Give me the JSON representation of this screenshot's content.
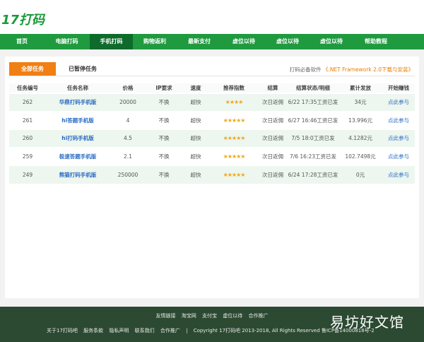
{
  "logo": "17打码",
  "nav": [
    "首页",
    "电脑打码",
    "手机打码",
    "购物返利",
    "最新支付",
    "虚位以待",
    "虚位以待",
    "虚位以待",
    "帮助教程"
  ],
  "tabs": {
    "all": "全部任务",
    "paused": "已暂停任务"
  },
  "notice": {
    "prefix": "打码必备软件 ",
    "link": "《.NET Framework 2.0下载与安装》"
  },
  "table": {
    "headers": [
      "任务编号",
      "任务名称",
      "价格",
      "IP要求",
      "速度",
      "推荐指数",
      "结算",
      "结算状态/明细",
      "累计发放",
      "开始赚钱"
    ],
    "rows": [
      {
        "id": "262",
        "name": "华鼎打码手机版",
        "price": "20000",
        "ip": "不换",
        "speed": "超快",
        "stars": 4,
        "settle": "次日返佣",
        "status": "6/22 17:35工资已发",
        "total": "34元",
        "action": "点此参与"
      },
      {
        "id": "261",
        "name": "hi答题手机版",
        "price": "4",
        "ip": "不换",
        "speed": "超快",
        "stars": 5,
        "settle": "次日返佣",
        "status": "6/27 16:46工资已发",
        "total": "13.996元",
        "action": "点此参与"
      },
      {
        "id": "260",
        "name": "hi打码手机版",
        "price": "4.5",
        "ip": "不换",
        "speed": "超快",
        "stars": 5,
        "settle": "次日返佣",
        "status": "7/5 18:0工资已发",
        "total": "4.1282元",
        "action": "点此参与"
      },
      {
        "id": "259",
        "name": "极速答题手机版",
        "price": "2.1",
        "ip": "不换",
        "speed": "超快",
        "stars": 5,
        "settle": "次日返佣",
        "status": "7/6 16:23工资已发",
        "total": "102.7498元",
        "action": "点此参与"
      },
      {
        "id": "249",
        "name": "熊猫打码手机版",
        "price": "250000",
        "ip": "不换",
        "speed": "超快",
        "stars": 5,
        "settle": "次日返佣",
        "status": "6/24 17:28工资已发",
        "total": "0元",
        "action": "点此参与"
      }
    ]
  },
  "footer": {
    "links": [
      "友情链接",
      "淘宝网",
      "支付宝",
      "虚位以待",
      "合作推广"
    ],
    "bottom": [
      "关于17打码吧",
      "服务条款",
      "隐私声明",
      "联系我们",
      "合作推广",
      "|",
      "Copyright 17打码吧 2013-2018, All Rights Reserved 鲁ICP备14000818号-2"
    ],
    "watermark": "易坊好文馆"
  }
}
